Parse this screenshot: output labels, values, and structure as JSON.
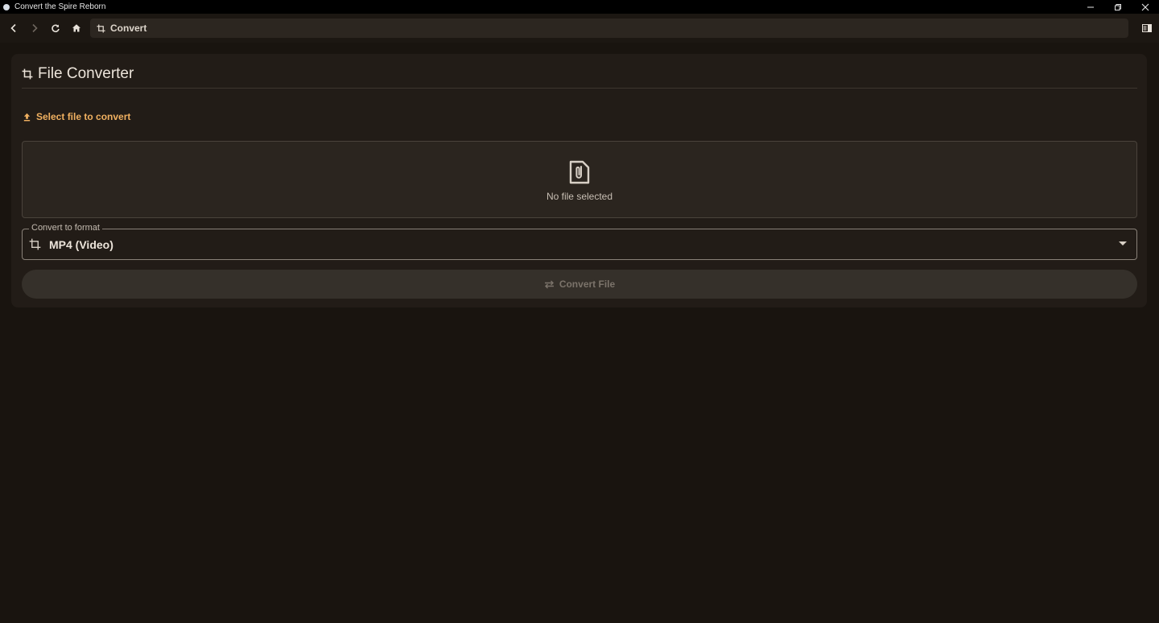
{
  "window": {
    "title": "Convert the Spire Reborn",
    "controls": [
      "minimize-icon",
      "restore-icon",
      "close-icon"
    ]
  },
  "nav": {
    "address_text": "Convert",
    "icons": [
      "back-arrow-icon",
      "forward-arrow-icon",
      "reload-icon",
      "home-icon",
      "crop-icon",
      "sidebar-toggle-icon"
    ]
  },
  "converter": {
    "title": "File Converter",
    "select_label": "Select file to convert",
    "dropzone_text": "No file selected",
    "format_legend": "Convert to format",
    "format_value": "MP4 (Video)",
    "convert_button_label": "Convert File"
  },
  "colors": {
    "background": "#19140f",
    "card": "#221c17",
    "accent": "#f0b060",
    "button_disabled": "#35302a"
  }
}
